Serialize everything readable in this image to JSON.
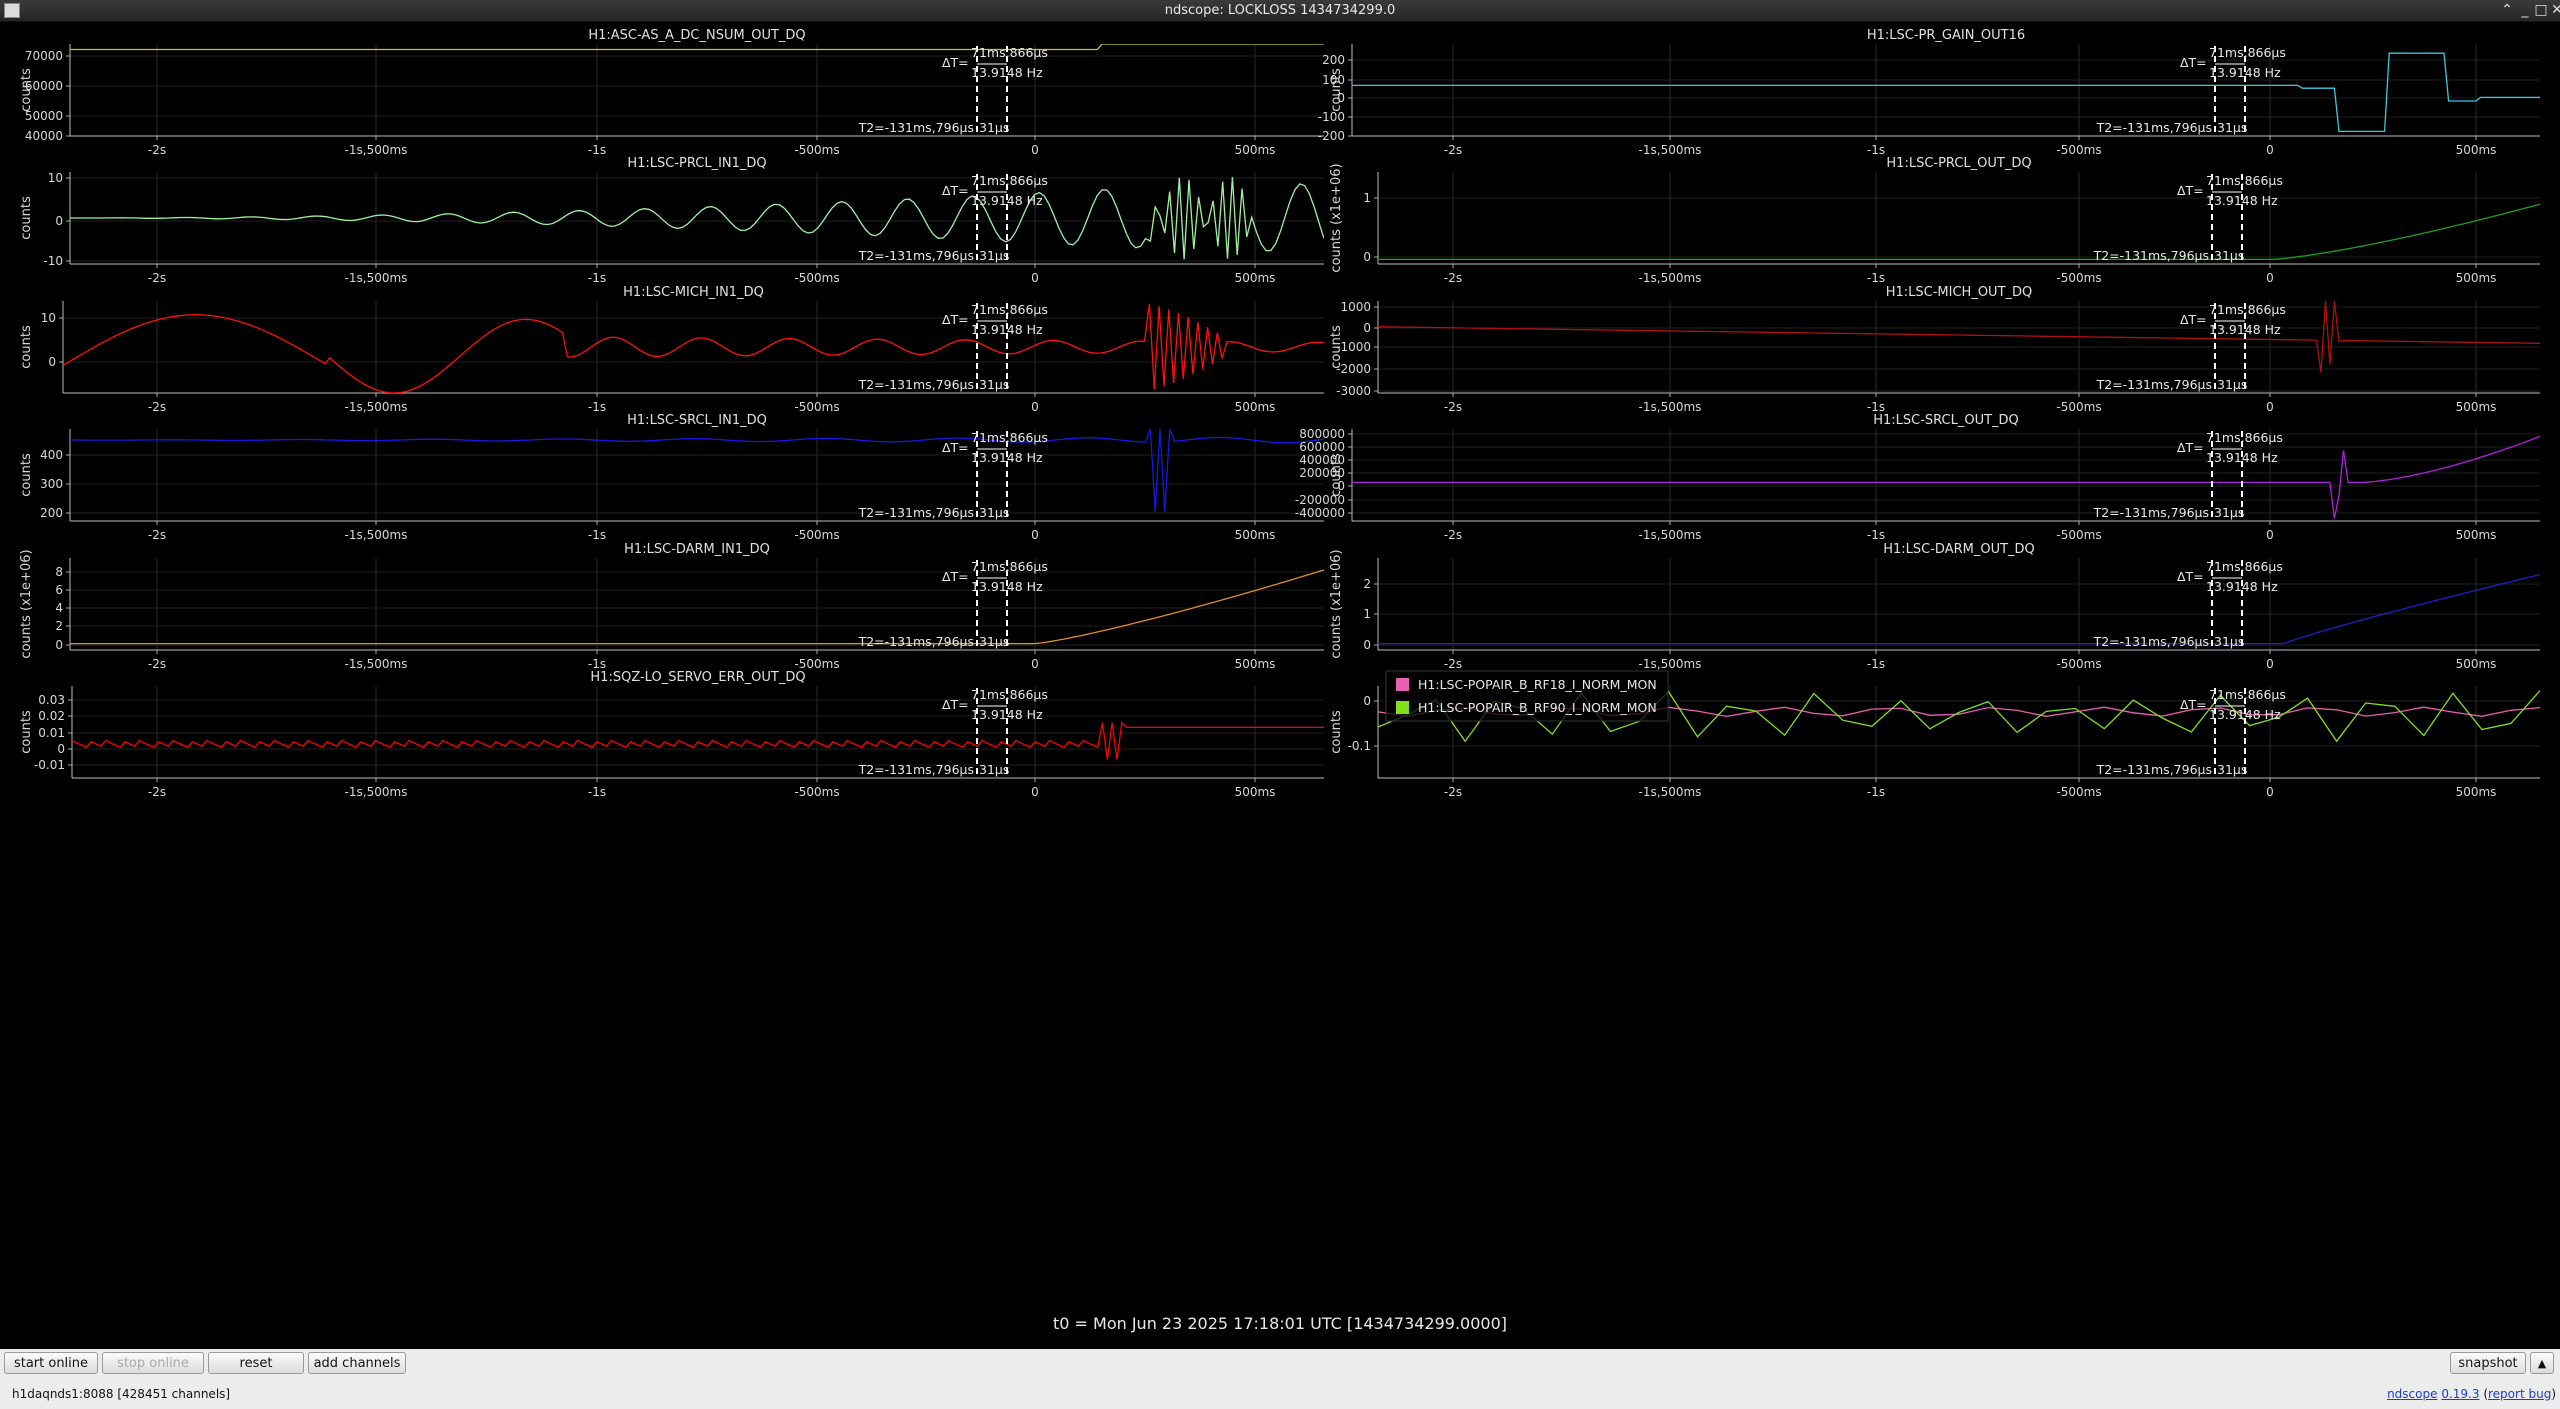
{
  "window": {
    "title": "ndscope: LOCKLOSS 1434734299.0"
  },
  "annotations": {
    "dt": "ΔT=",
    "t1": "71ms,866μs",
    "freq": "13.9148 Hz",
    "t2": "T2=-131ms,796μs",
    "t2_tail": "31μs"
  },
  "x_ticks": [
    "-2s",
    "-1s,500ms",
    "-1s",
    "-500ms",
    "0",
    "500ms"
  ],
  "plots": [
    {
      "channel": "H1:ASC-AS_A_DC_NSUM_OUT_DQ",
      "ylabel": "counts",
      "yticks": [
        "40000",
        "50000",
        "60000",
        "70000"
      ],
      "color": "#c8c832"
    },
    {
      "channel": "H1:LSC-PR_GAIN_OUT16",
      "ylabel": "counts",
      "yticks": [
        "-200",
        "-100",
        "0",
        "100",
        "200"
      ],
      "color": "#3cc8dc"
    },
    {
      "channel": "H1:LSC-PRCL_IN1_DQ",
      "ylabel": "counts",
      "yticks": [
        "-10",
        "0",
        "10"
      ],
      "color": "#a0f0a0"
    },
    {
      "channel": "H1:LSC-PRCL_OUT_DQ",
      "ylabel": "counts (x1e+06)",
      "yticks": [
        "0",
        "1"
      ],
      "color": "#1ea01e"
    },
    {
      "channel": "H1:LSC-MICH_IN1_DQ",
      "ylabel": "counts",
      "yticks": [
        "0",
        "10"
      ],
      "color": "#ff1010"
    },
    {
      "channel": "H1:LSC-MICH_OUT_DQ",
      "ylabel": "counts",
      "yticks": [
        "-3000",
        "-2000",
        "-1000",
        "0",
        "1000"
      ],
      "color": "#b01010"
    },
    {
      "channel": "H1:LSC-SRCL_IN1_DQ",
      "ylabel": "counts",
      "yticks": [
        "200",
        "300",
        "400"
      ],
      "color": "#1818e0"
    },
    {
      "channel": "H1:LSC-SRCL_OUT_DQ",
      "ylabel": "counts",
      "yticks": [
        "-400000",
        "-200000",
        "0",
        "200000",
        "400000",
        "600000",
        "800000"
      ],
      "color": "#b020e0"
    },
    {
      "channel": "H1:LSC-DARM_IN1_DQ",
      "ylabel": "counts (x1e+06)",
      "yticks": [
        "0",
        "2",
        "4",
        "6",
        "8"
      ],
      "color": "#e09020"
    },
    {
      "channel": "H1:LSC-DARM_OUT_DQ",
      "ylabel": "counts (x1e+06)",
      "yticks": [
        "0",
        "1",
        "2"
      ],
      "color": "#2020c8"
    },
    {
      "channel": "H1:SQZ-LO_SERVO_ERR_OUT_DQ",
      "ylabel": "counts",
      "yticks": [
        "-0.01",
        "0",
        "0.01",
        "0.02",
        "0.03"
      ],
      "color": "#ff0000"
    },
    {
      "channel": "",
      "ylabel": "counts",
      "yticks": [
        "-0.1",
        "0"
      ],
      "color": "#e860b0",
      "legend": [
        {
          "name": "H1:LSC-POPAIR_B_RF18_I_NORM_MON",
          "color": "#e860b0"
        },
        {
          "name": "H1:LSC-POPAIR_B_RF90_I_NORM_MON",
          "color": "#80e020"
        }
      ]
    }
  ],
  "footer": {
    "t0": "t0 = Mon Jun 23 2025 17:18:01 UTC [1434734299.0000]"
  },
  "toolbar": {
    "start_online": "start online",
    "stop_online": "stop online",
    "reset": "reset",
    "add_channels": "add channels",
    "snapshot": "snapshot"
  },
  "status": {
    "server": "h1daqnds1:8088",
    "channels": "[428451 channels]",
    "app": "ndscope",
    "version": "0.19.3",
    "report": "report bug"
  }
}
